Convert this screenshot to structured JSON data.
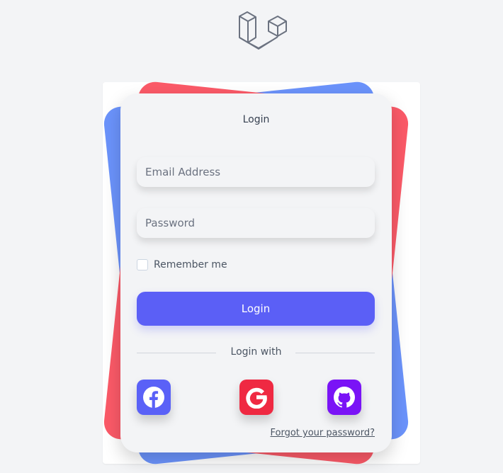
{
  "card": {
    "title": "Login"
  },
  "form": {
    "email_placeholder": "Email Address",
    "password_placeholder": "Password",
    "remember_label": "Remember me",
    "login_button": "Login",
    "divider_label": "Login with",
    "forgot_link": "Forgot your password?"
  },
  "colors": {
    "login_button": "#5b5ff6",
    "facebook": "#5a61f7",
    "google": "#ef2942",
    "github": "#7a13f6",
    "deco_blue": "#6b93fb",
    "deco_red": "#fb5a68"
  },
  "icons": {
    "logo": "laravel-logo",
    "facebook": "facebook-icon",
    "google": "google-icon",
    "github": "github-icon"
  }
}
